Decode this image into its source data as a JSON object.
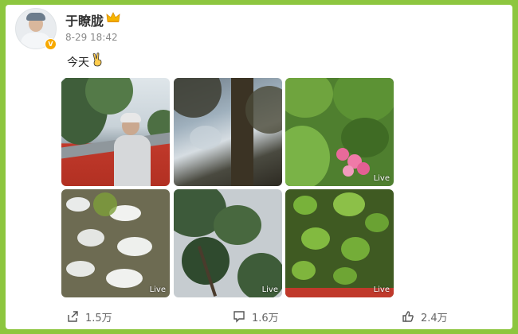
{
  "post": {
    "username": "于瞭胧",
    "timestamp": "8-29 18:42",
    "text": "今天",
    "photos": [
      {
        "live": ""
      },
      {
        "live": ""
      },
      {
        "live": "Live"
      },
      {
        "live": "Live"
      },
      {
        "live": "Live"
      },
      {
        "live": "Live"
      }
    ]
  },
  "actions": {
    "share_count": "1.5万",
    "comment_count": "1.6万",
    "like_count": "2.4万"
  },
  "colors": {
    "frame": "#8dc63f",
    "card": "#ffffff",
    "vip_badge": "#f7a900"
  },
  "icons": [
    "avatar",
    "verified-badge-icon",
    "crown-icon",
    "victory-hand-icon",
    "share-icon",
    "comment-icon",
    "like-icon"
  ]
}
